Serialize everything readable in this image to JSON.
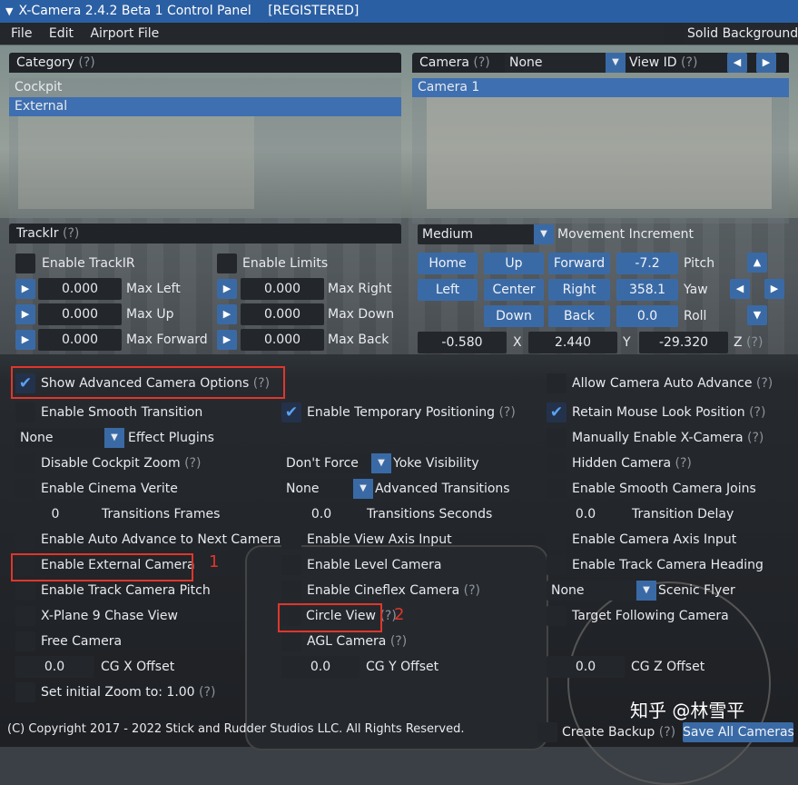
{
  "title": "X-Camera 2.4.2 Beta 1 Control Panel",
  "title_status": "[REGISTERED]",
  "menu": [
    "File",
    "Edit",
    "Airport File"
  ],
  "solid_background": "Solid Background",
  "category": {
    "header": "Category",
    "help": "(?)",
    "items": [
      "Cockpit",
      "External"
    ]
  },
  "camera": {
    "header": "Camera",
    "help": "(?)",
    "dropdown": "None",
    "view_id_label": "View ID",
    "view_id_help": "(?)",
    "items": [
      "Camera 1"
    ]
  },
  "trackir": {
    "header": "TrackIr",
    "help": "(?)",
    "enable_trackir": "Enable TrackIR",
    "enable_limits": "Enable Limits",
    "rows": [
      {
        "left_value": "0.000",
        "left_label": "Max Left",
        "right_value": "0.000",
        "right_label": "Max Right"
      },
      {
        "left_value": "0.000",
        "left_label": "Max Up",
        "right_value": "0.000",
        "right_label": "Max Down"
      },
      {
        "left_value": "0.000",
        "left_label": "Max Forward",
        "right_value": "0.000",
        "right_label": "Max Back"
      }
    ]
  },
  "movement": {
    "increment_value": "Medium",
    "increment_label": "Movement Increment",
    "btn_home": "Home",
    "btn_up": "Up",
    "btn_forward": "Forward",
    "btn_left": "Left",
    "btn_center": "Center",
    "btn_right": "Right",
    "btn_down": "Down",
    "btn_back": "Back",
    "pitch_value": "-7.2",
    "pitch_label": "Pitch",
    "yaw_value": "358.1",
    "yaw_label": "Yaw",
    "roll_value": "0.0",
    "roll_label": "Roll",
    "x_value": "-0.580",
    "x_label": "X",
    "y_value": "2.440",
    "y_label": "Y",
    "z_value": "-29.320",
    "z_label": "Z",
    "z_help": "(?)"
  },
  "advanced": {
    "show_advanced": "Show Advanced Camera Options",
    "show_advanced_help": "(?)",
    "allow_auto_advance": "Allow Camera Auto Advance",
    "allow_auto_advance_help": "(?)",
    "enable_smooth_transition": "Enable Smooth Transition",
    "enable_temporary_positioning": "Enable Temporary Positioning",
    "enable_temporary_positioning_help": "(?)",
    "retain_mouse_look": "Retain Mouse Look Position",
    "retain_mouse_look_help": "(?)",
    "effect_plugins_value": "None",
    "effect_plugins_label": "Effect Plugins",
    "manually_enable": "Manually Enable X-Camera",
    "manually_enable_help": "(?)",
    "disable_cockpit_zoom": "Disable Cockpit Zoom",
    "disable_cockpit_zoom_help": "(?)",
    "yoke_value": "Don't Force",
    "yoke_label": "Yoke Visibility",
    "hidden_camera": "Hidden Camera",
    "hidden_camera_help": "(?)",
    "enable_cinema_verite": "Enable Cinema Verite",
    "adv_transitions_value": "None",
    "adv_transitions_label": "Advanced Transitions",
    "enable_smooth_joins": "Enable Smooth Camera Joins",
    "transition_frames_value": "0",
    "transition_frames_label": "Transitions Frames",
    "transition_seconds_value": "0.0",
    "transition_seconds_label": "Transitions Seconds",
    "transition_delay_value": "0.0",
    "transition_delay_label": "Transition Delay",
    "enable_auto_advance": "Enable Auto Advance to Next Camera",
    "enable_view_axis": "Enable View Axis Input",
    "enable_camera_axis": "Enable Camera Axis Input",
    "enable_external_camera": "Enable External Camera",
    "enable_level_camera": "Enable Level Camera",
    "enable_track_heading": "Enable Track Camera Heading",
    "enable_track_pitch": "Enable Track Camera Pitch",
    "enable_cineflex": "Enable Cineflex Camera",
    "enable_cineflex_help": "(?)",
    "scenic_value": "None",
    "scenic_label": "Scenic Flyer",
    "xplane9_chase": "X-Plane 9 Chase View",
    "circle_view": "Circle View",
    "circle_view_help": "(?)",
    "target_following": "Target Following Camera",
    "free_camera": "Free Camera",
    "agl_camera": "AGL Camera",
    "agl_camera_help": "(?)",
    "cgx_value": "0.0",
    "cgx_label": "CG X Offset",
    "cgy_value": "0.0",
    "cgy_label": "CG Y Offset",
    "cgz_value": "0.0",
    "cgz_label": "CG Z Offset",
    "initial_zoom": "Set initial Zoom to: 1.00",
    "initial_zoom_help": "(?)"
  },
  "annotations": {
    "mark1": "1",
    "mark2": "2"
  },
  "footer": {
    "copyright": "(C) Copyright 2017 - 2022 Stick and Rudder Studios LLC. All Rights Reserved.",
    "create_backup": "Create Backup",
    "create_backup_help": "(?)",
    "save_all": "Save All Cameras"
  },
  "watermark": "知乎 @林雪平",
  "colors": {
    "accent": "#3a6aa6",
    "titlebar": "#2b5fa3",
    "annotation": "#e0362b"
  }
}
